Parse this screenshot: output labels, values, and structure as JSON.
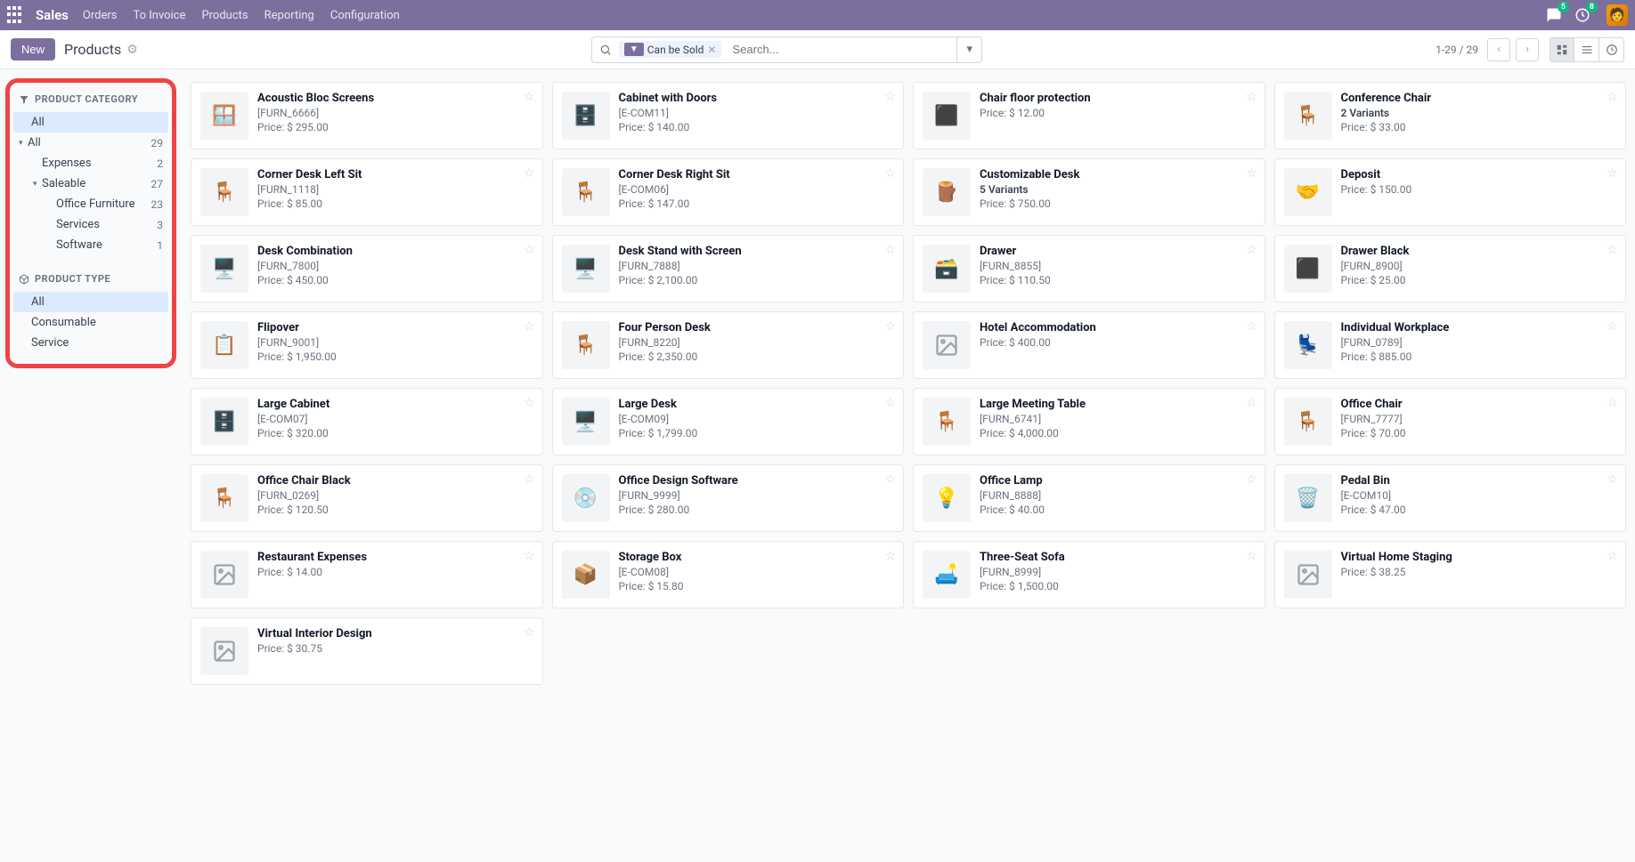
{
  "topbar": {
    "brand": "Sales",
    "nav": [
      "Orders",
      "To Invoice",
      "Products",
      "Reporting",
      "Configuration"
    ],
    "msg_badge": "5",
    "activity_badge": "8"
  },
  "toolbar": {
    "new_label": "New",
    "breadcrumb": "Products",
    "search_placeholder": "Search...",
    "filter_chip": "Can be Sold",
    "pager": "1-29 / 29"
  },
  "sidebar": {
    "cat_header": "PRODUCT CATEGORY",
    "type_header": "PRODUCT TYPE",
    "cat_all": "All",
    "tree": [
      {
        "label": "All",
        "count": "29",
        "caret": true,
        "indent": 0
      },
      {
        "label": "Expenses",
        "count": "2",
        "caret": false,
        "indent": 1
      },
      {
        "label": "Saleable",
        "count": "27",
        "caret": true,
        "indent": 1
      },
      {
        "label": "Office Furniture",
        "count": "23",
        "caret": false,
        "indent": 2
      },
      {
        "label": "Services",
        "count": "3",
        "caret": false,
        "indent": 2
      },
      {
        "label": "Software",
        "count": "1",
        "caret": false,
        "indent": 2
      }
    ],
    "types": [
      {
        "label": "All",
        "active": true
      },
      {
        "label": "Consumable",
        "active": false
      },
      {
        "label": "Service",
        "active": false
      }
    ]
  },
  "price_label": "Price: ",
  "products": [
    {
      "name": "Acoustic Bloc Screens",
      "sku": "[FURN_6666]",
      "price": "$ 295.00",
      "emoji": "🪟"
    },
    {
      "name": "Cabinet with Doors",
      "sku": "[E-COM11]",
      "price": "$ 140.00",
      "emoji": "🗄️"
    },
    {
      "name": "Chair floor protection",
      "sku": "",
      "price": "$ 12.00",
      "emoji": "⬛"
    },
    {
      "name": "Conference Chair",
      "sku": "",
      "subtitle": "2 Variants",
      "price": "$ 33.00",
      "emoji": "🪑"
    },
    {
      "name": "Corner Desk Left Sit",
      "sku": "[FURN_1118]",
      "price": "$ 85.00",
      "emoji": "🪑"
    },
    {
      "name": "Corner Desk Right Sit",
      "sku": "[E-COM06]",
      "price": "$ 147.00",
      "emoji": "🪑"
    },
    {
      "name": "Customizable Desk",
      "sku": "",
      "subtitle": "5 Variants",
      "price": "$ 750.00",
      "emoji": "🪵"
    },
    {
      "name": "Deposit",
      "sku": "",
      "price": "$ 150.00",
      "emoji": "🤝"
    },
    {
      "name": "Desk Combination",
      "sku": "[FURN_7800]",
      "price": "$ 450.00",
      "emoji": "🖥️"
    },
    {
      "name": "Desk Stand with Screen",
      "sku": "[FURN_7888]",
      "price": "$ 2,100.00",
      "emoji": "🖥️"
    },
    {
      "name": "Drawer",
      "sku": "[FURN_8855]",
      "price": "$ 110.50",
      "emoji": "🗃️"
    },
    {
      "name": "Drawer Black",
      "sku": "[FURN_8900]",
      "price": "$ 25.00",
      "emoji": "⬛"
    },
    {
      "name": "Flipover",
      "sku": "[FURN_9001]",
      "price": "$ 1,950.00",
      "emoji": "📋"
    },
    {
      "name": "Four Person Desk",
      "sku": "[FURN_8220]",
      "price": "$ 2,350.00",
      "emoji": "🪑"
    },
    {
      "name": "Hotel Accommodation",
      "sku": "",
      "price": "$ 400.00",
      "emoji": "",
      "placeholder": true
    },
    {
      "name": "Individual Workplace",
      "sku": "[FURN_0789]",
      "price": "$ 885.00",
      "emoji": "💺"
    },
    {
      "name": "Large Cabinet",
      "sku": "[E-COM07]",
      "price": "$ 320.00",
      "emoji": "🗄️"
    },
    {
      "name": "Large Desk",
      "sku": "[E-COM09]",
      "price": "$ 1,799.00",
      "emoji": "🖥️"
    },
    {
      "name": "Large Meeting Table",
      "sku": "[FURN_6741]",
      "price": "$ 4,000.00",
      "emoji": "🪑"
    },
    {
      "name": "Office Chair",
      "sku": "[FURN_7777]",
      "price": "$ 70.00",
      "emoji": "🪑"
    },
    {
      "name": "Office Chair Black",
      "sku": "[FURN_0269]",
      "price": "$ 120.50",
      "emoji": "🪑"
    },
    {
      "name": "Office Design Software",
      "sku": "[FURN_9999]",
      "price": "$ 280.00",
      "emoji": "💿"
    },
    {
      "name": "Office Lamp",
      "sku": "[FURN_8888]",
      "price": "$ 40.00",
      "emoji": "💡"
    },
    {
      "name": "Pedal Bin",
      "sku": "[E-COM10]",
      "price": "$ 47.00",
      "emoji": "🗑️"
    },
    {
      "name": "Restaurant Expenses",
      "sku": "",
      "price": "$ 14.00",
      "emoji": "",
      "placeholder": true
    },
    {
      "name": "Storage Box",
      "sku": "[E-COM08]",
      "price": "$ 15.80",
      "emoji": "📦"
    },
    {
      "name": "Three-Seat Sofa",
      "sku": "[FURN_8999]",
      "price": "$ 1,500.00",
      "emoji": "🛋️"
    },
    {
      "name": "Virtual Home Staging",
      "sku": "",
      "price": "$ 38.25",
      "emoji": "",
      "placeholder": true
    },
    {
      "name": "Virtual Interior Design",
      "sku": "",
      "price": "$ 30.75",
      "emoji": "",
      "placeholder": true
    }
  ]
}
